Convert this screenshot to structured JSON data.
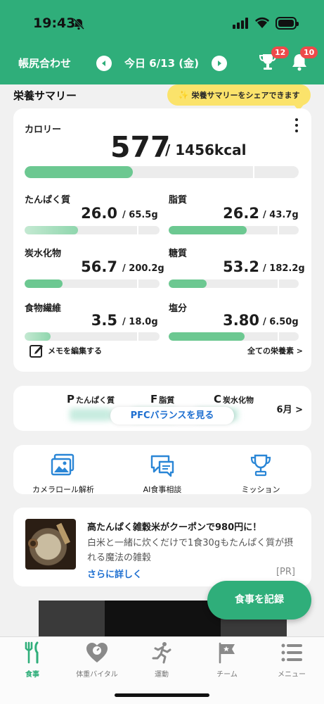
{
  "status_bar": {
    "time": "19:43"
  },
  "header": {
    "brand": "帳尻合わせ",
    "date_label": "今日 6/13 (金)",
    "trophy_badge": "12",
    "bell_badge": "10",
    "accent_color": "#2fae7a"
  },
  "summary": {
    "title": "栄養サマリー",
    "share_tooltip": "栄養サマリーをシェアできます",
    "calorie": {
      "label": "カロリー",
      "value": "577",
      "total": "/ 1456kcal",
      "progress": 0.396
    },
    "nutrients": [
      {
        "label": "たんぱく質",
        "value": "26.0",
        "unit": "/ 65.5g",
        "progress": 0.397
      },
      {
        "label": "脂質",
        "value": "26.2",
        "unit": "/ 43.7g",
        "progress": 0.6
      },
      {
        "label": "炭水化物",
        "value": "56.7",
        "unit": "/ 200.2g",
        "progress": 0.283
      },
      {
        "label": "糖質",
        "value": "53.2",
        "unit": "/ 182.2g",
        "progress": 0.292
      },
      {
        "label": "食物繊維",
        "value": "3.5",
        "unit": "/ 18.0g",
        "progress": 0.194
      },
      {
        "label": "塩分",
        "value": "3.80",
        "unit": "/ 6.50g",
        "progress": 0.585
      }
    ],
    "memo_label": "メモを編集する",
    "all_nutrients_label": "全ての栄養素 >"
  },
  "pfc": {
    "p_letter": "P",
    "p_label": "たんぱく質",
    "f_letter": "F",
    "f_label": "脂質",
    "c_letter": "C",
    "c_label": "炭水化物",
    "button_label": "PFCバランスを見る",
    "month_label": "6月 >"
  },
  "quick_actions": [
    {
      "label": "カメラロール解析",
      "icon": "image-icon"
    },
    {
      "label": "AI食事相談",
      "icon": "chat-icon"
    },
    {
      "label": "ミッション",
      "icon": "trophy-icon"
    }
  ],
  "ad": {
    "title": "高たんぱく雑穀米がクーポンで980円に！",
    "description": "白米と一緒に炊くだけで1食30gもたんぱく質が摂れる魔法の雑穀",
    "more_label": "さらに詳しく",
    "pr_label": "[PR]"
  },
  "fab_label": "食事を記録",
  "tabs": [
    {
      "label": "食事",
      "icon": "fork-knife-icon",
      "active": true
    },
    {
      "label": "体重バイタル",
      "icon": "heart-scale-icon",
      "active": false
    },
    {
      "label": "運動",
      "icon": "runner-icon",
      "active": false
    },
    {
      "label": "チーム",
      "icon": "flag-icon",
      "active": false
    },
    {
      "label": "メニュー",
      "icon": "menu-list-icon",
      "active": false
    }
  ]
}
